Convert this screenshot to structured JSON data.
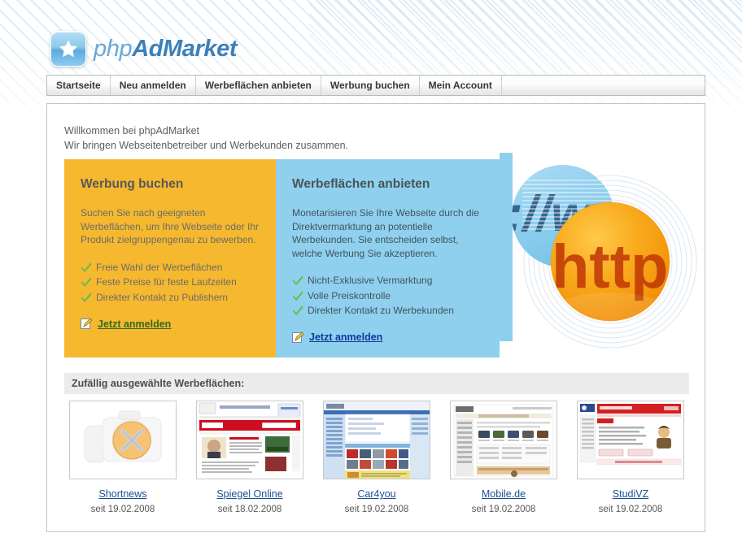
{
  "site": {
    "logo_text_1": "php",
    "logo_text_2": "Ad",
    "logo_text_3": "Market",
    "logo_icon": "star-icon"
  },
  "nav": {
    "items": [
      {
        "label": "Startseite"
      },
      {
        "label": "Neu anmelden"
      },
      {
        "label": "Werbeflächen anbieten"
      },
      {
        "label": "Werbung buchen"
      },
      {
        "label": "Mein Account"
      }
    ]
  },
  "welcome": {
    "line1": "Willkommen bei phpAdMarket",
    "line2": "Wir bringen Webseitenbetreiber und Werbekunden zusammen."
  },
  "panels": {
    "advertiser": {
      "title": "Werbung buchen",
      "body": "Suchen Sie nach geeigneten Werbeflächen, um Ihre Webseite oder Ihr Produkt zielgruppengenau zu bewerben.",
      "bullets": [
        "Freie Wahl der Werbeflächen",
        "Feste Preise für feste Laufzeiten",
        "Direkter Kontakt zu Publishern"
      ],
      "link_label": "Jetzt anmelden",
      "bg_color": "#f5b82f",
      "link_color": "#2f6b22"
    },
    "publisher": {
      "title": "Werbeflächen anbieten",
      "body": "Monetarisieren Sie Ihre Webseite durch die Direktvermarktung an potentielle Werbekunden. Sie entscheiden selbst, welche Werbung Sie akzeptieren.",
      "bullets": [
        "Nicht-Exklusive Vermarktung",
        "Volle Preiskontrolle",
        "Direkter Kontakt zu Werbekunden"
      ],
      "link_label": "Jetzt anmelden",
      "bg_color": "#8ed0ee",
      "link_color": "#11399b"
    },
    "graphic": {
      "protocol_text": "://ww",
      "sphere_text": "http",
      "sphere_color": "#f6a61c",
      "disc_color": "#8ecfee"
    }
  },
  "random_ads": {
    "header": "Zufällig ausgewählte Werbeflächen:",
    "items": [
      {
        "name": "Shortnews",
        "since": "seit 19.02.2008",
        "thumb": "placeholder-camera"
      },
      {
        "name": "Spiegel Online",
        "since": "seit 18.02.2008",
        "thumb": "news-site"
      },
      {
        "name": "Car4you",
        "since": "seit 19.02.2008",
        "thumb": "car-portal"
      },
      {
        "name": "Mobile.de",
        "since": "seit 19.02.2008",
        "thumb": "vehicle-list"
      },
      {
        "name": "StudiVZ",
        "since": "seit 19.02.2008",
        "thumb": "social-form"
      }
    ]
  }
}
